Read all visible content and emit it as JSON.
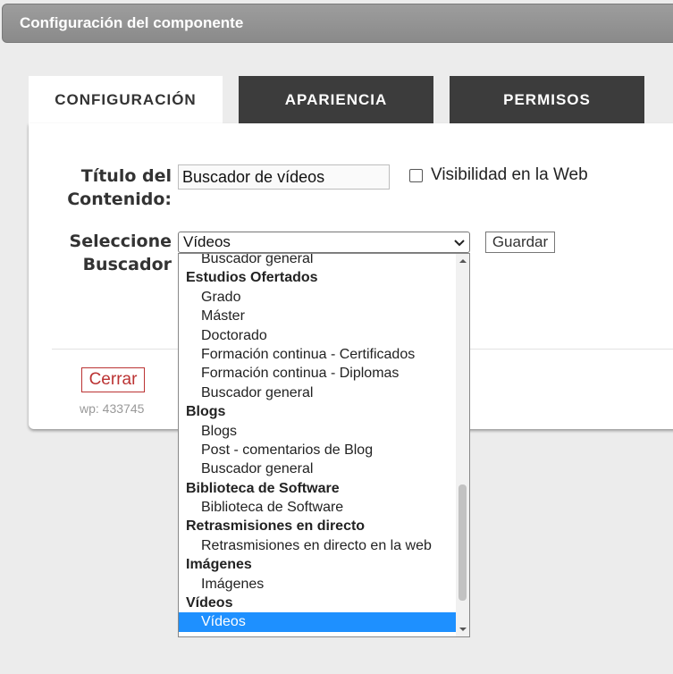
{
  "window": {
    "title": "Configuración del componente"
  },
  "tabs": [
    {
      "label": "CONFIGURACIÓN",
      "active": true
    },
    {
      "label": "APARIENCIA",
      "active": false
    },
    {
      "label": "PERMISOS",
      "active": false
    }
  ],
  "form": {
    "title_label_line1": "Título del",
    "title_label_line2": "Contenido:",
    "title_value": "Buscador de vídeos",
    "visibility_label": "Visibilidad en la Web",
    "visibility_checked": false,
    "search_label_line1": "Seleccione",
    "search_label_line2": "Buscador",
    "search_selected": "Vídeos",
    "save_label": "Guardar"
  },
  "footer": {
    "close_label": "Cerrar",
    "wp_id": "wp: 433745"
  },
  "dropdown": {
    "items": [
      {
        "type": "option",
        "label": "Buscador general"
      },
      {
        "type": "group",
        "label": "Estudios Ofertados"
      },
      {
        "type": "option",
        "label": "Grado"
      },
      {
        "type": "option",
        "label": "Máster"
      },
      {
        "type": "option",
        "label": "Doctorado"
      },
      {
        "type": "option",
        "label": "Formación continua - Certificados"
      },
      {
        "type": "option",
        "label": "Formación continua - Diplomas"
      },
      {
        "type": "option",
        "label": "Buscador general"
      },
      {
        "type": "group",
        "label": "Blogs"
      },
      {
        "type": "option",
        "label": "Blogs"
      },
      {
        "type": "option",
        "label": "Post - comentarios de Blog"
      },
      {
        "type": "option",
        "label": "Buscador general"
      },
      {
        "type": "group",
        "label": "Biblioteca de Software"
      },
      {
        "type": "option",
        "label": "Biblioteca de Software"
      },
      {
        "type": "group",
        "label": "Retrasmisiones en directo"
      },
      {
        "type": "option",
        "label": "Retrasmisiones en directo en la web"
      },
      {
        "type": "group",
        "label": "Imágenes"
      },
      {
        "type": "option",
        "label": "Imágenes"
      },
      {
        "type": "group",
        "label": "Vídeos"
      },
      {
        "type": "option",
        "label": "Vídeos",
        "selected": true
      }
    ]
  },
  "colors": {
    "tab_inactive": "#3c3c3c",
    "selected": "#1e90ff",
    "close": "#b33333"
  }
}
